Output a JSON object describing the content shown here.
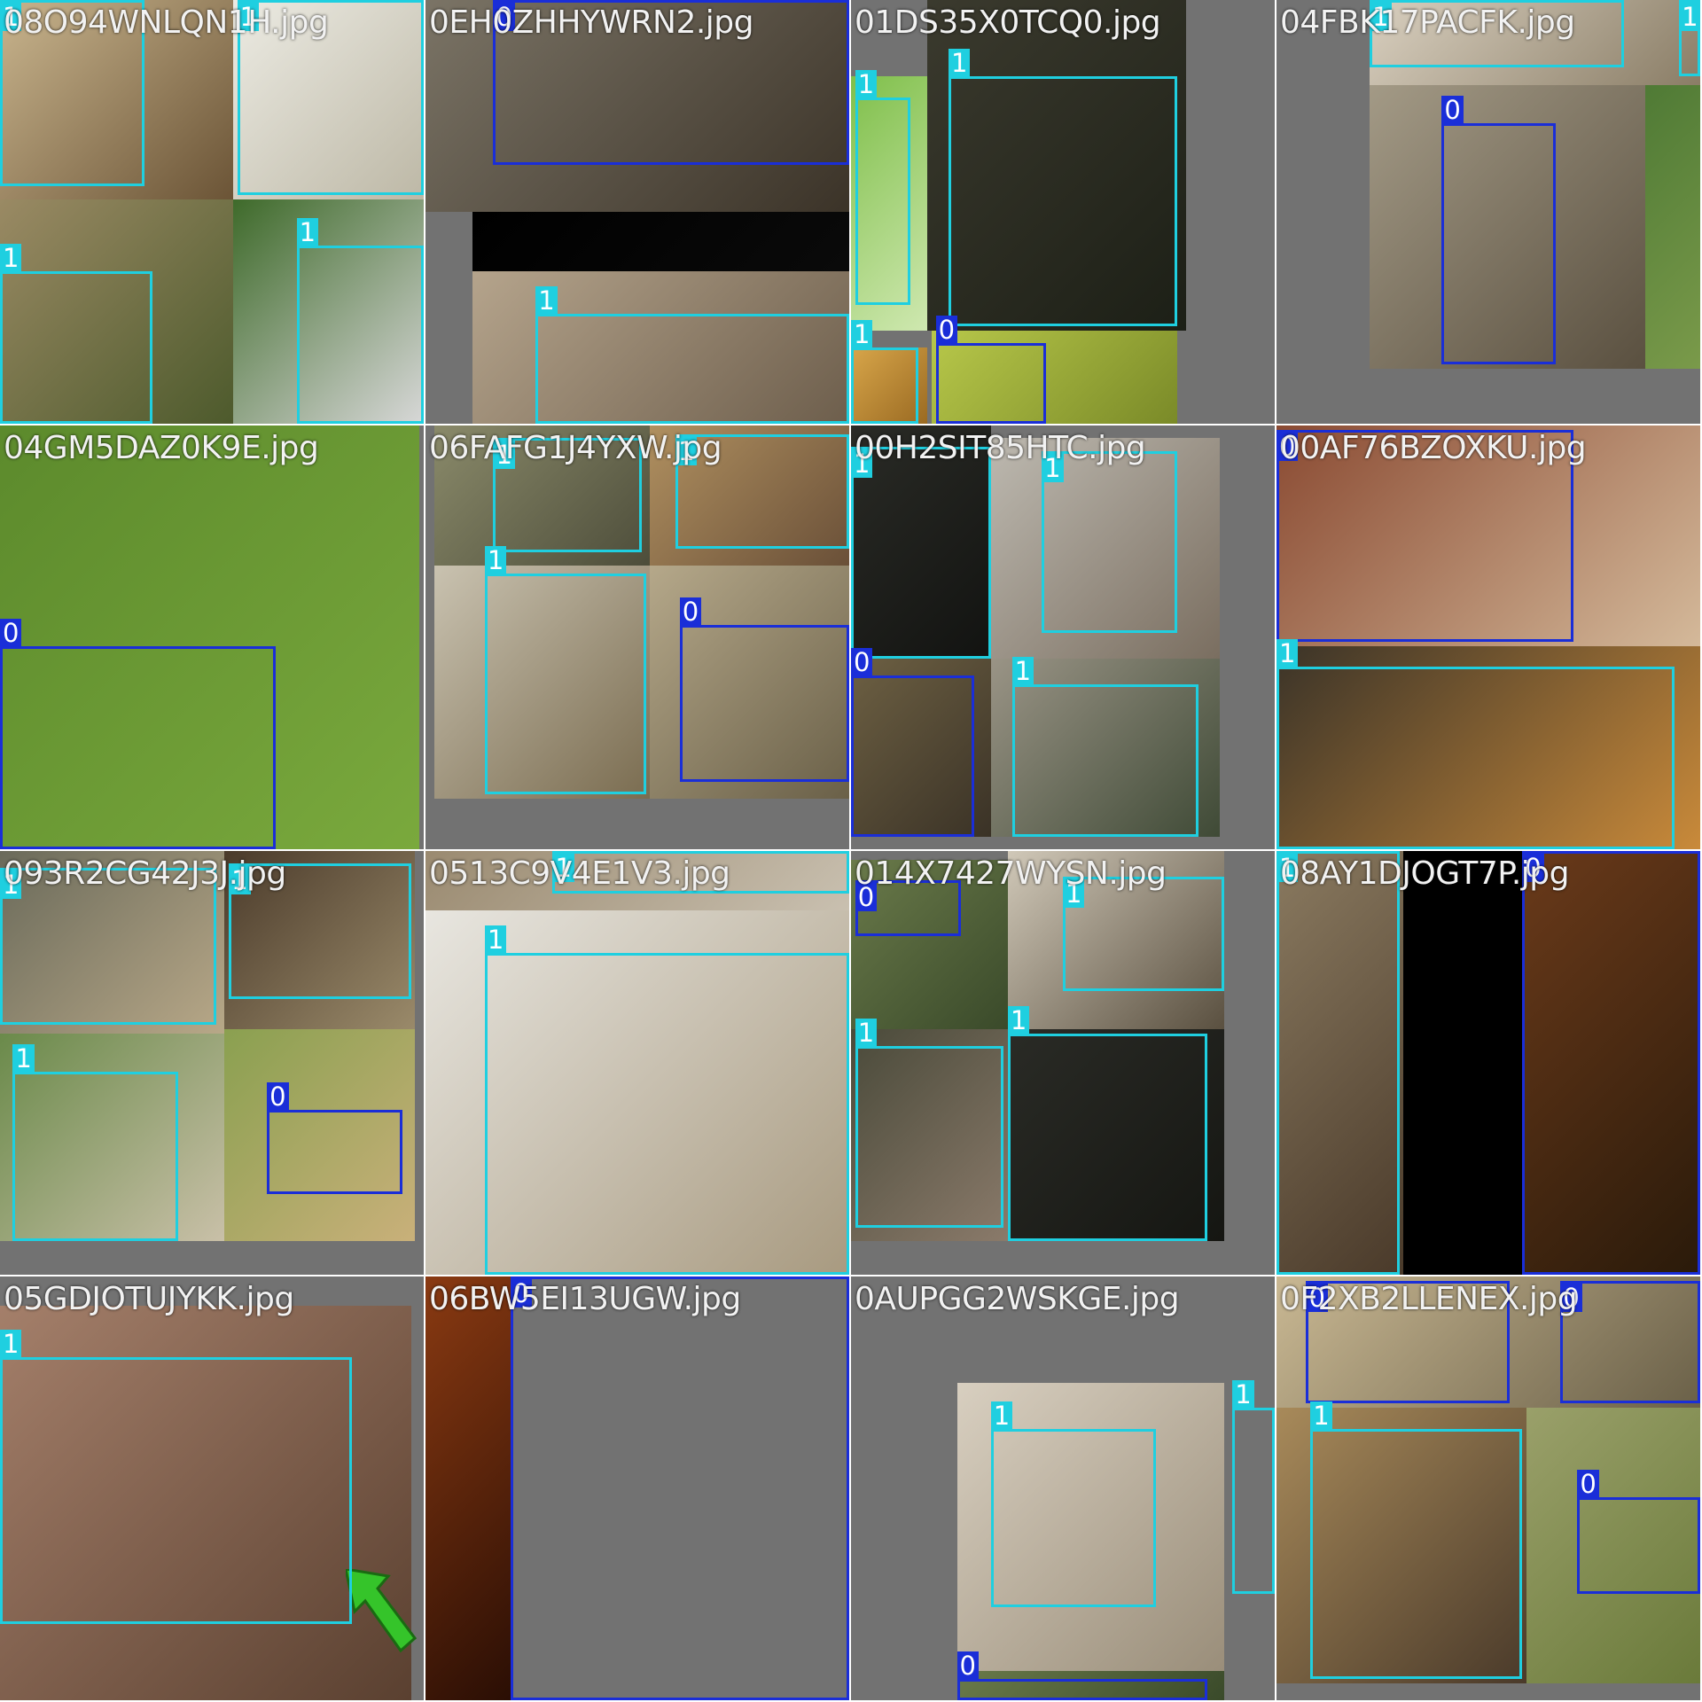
{
  "classes": {
    "0": {
      "color": "#1a2ed8"
    },
    "1": {
      "color": "#1fcfe0"
    }
  },
  "tiles": [
    {
      "filename": "08O94WNLQN1H.jpg",
      "photos": [
        [
          "#c9b58e",
          "#6b5436"
        ],
        [
          "#ecebe3",
          "#bdb8a6"
        ],
        [
          "#9a8a64",
          "#4d5a2c"
        ],
        [
          "#3e6a2a",
          "#d8d8d8"
        ]
      ],
      "boxes": [
        [
          "1",
          0,
          0,
          0.34,
          0.44
        ],
        [
          "1",
          0.56,
          0,
          1,
          0.46
        ],
        [
          "1",
          0,
          0.64,
          0.36,
          1
        ],
        [
          "1",
          0.7,
          0.58,
          1,
          1
        ]
      ]
    },
    {
      "filename": "0EH0ZHHYWRN2.jpg",
      "photos": [
        [
          "#7b7466",
          "#3b3328"
        ],
        [
          "#000000",
          "#0a0a0a"
        ],
        [
          "#b5a48c",
          "#6d5e4c"
        ]
      ],
      "boxes": [
        [
          "0",
          0.16,
          0,
          1,
          0.39
        ],
        [
          "1",
          0.26,
          0.74,
          1,
          1
        ]
      ]
    },
    {
      "filename": "01DS35X0TCQ0.jpg",
      "photos": [
        [
          "#3b3a2e",
          "#1c1f16"
        ],
        [
          "#7fbf4a",
          "#cfe8b0"
        ],
        [
          "#d8a64a",
          "#9a6a22"
        ],
        [
          "#b8c84a",
          "#7a8a28"
        ]
      ],
      "boxes": [
        [
          "1",
          0.23,
          0.18,
          0.77,
          0.77
        ],
        [
          "1",
          0.01,
          0.23,
          0.14,
          0.72
        ],
        [
          "1",
          0,
          0.82,
          0.16,
          1
        ],
        [
          "0",
          0.2,
          0.81,
          0.46,
          1
        ]
      ]
    },
    {
      "filename": "04FBK17PACFK.jpg",
      "photos": [
        [
          "#d9d0c0",
          "#8a7d66"
        ],
        [
          "#a39a86",
          "#5a5040"
        ],
        [
          "#4f7a35",
          "#7a9a4a"
        ]
      ],
      "boxes": [
        [
          "1",
          0.22,
          0,
          0.82,
          0.16
        ],
        [
          "0",
          0.39,
          0.29,
          0.66,
          0.86
        ],
        [
          "1",
          0.95,
          0,
          1,
          0.18
        ]
      ]
    },
    {
      "filename": "04GM5DAZ0K9E.jpg",
      "photos": [
        [
          "#5c8a2c",
          "#7aa93d"
        ]
      ],
      "boxes": [
        [
          "0",
          0,
          0.52,
          0.65,
          1
        ]
      ]
    },
    {
      "filename": "06FAFG1J4YXW.jpg",
      "photos": [
        [
          "#8a8a6a",
          "#4d4d3a"
        ],
        [
          "#b09060",
          "#6a5038"
        ],
        [
          "#c9c2b0",
          "#7a6c50"
        ],
        [
          "#b5a88a",
          "#6a6048"
        ]
      ],
      "boxes": [
        [
          "1",
          0.16,
          0.03,
          0.51,
          0.3
        ],
        [
          "1",
          0.59,
          0.02,
          1,
          0.29
        ],
        [
          "1",
          0.14,
          0.35,
          0.52,
          0.87
        ],
        [
          "0",
          0.6,
          0.47,
          1,
          0.84
        ]
      ]
    },
    {
      "filename": "00H2SIT85HTC.jpg",
      "photos": [
        [
          "#2a2b26",
          "#121311"
        ],
        [
          "#bdb9b0",
          "#7a6e60"
        ],
        [
          "#6d6043",
          "#3a3226"
        ],
        [
          "#9a9486",
          "#3f4a36"
        ]
      ],
      "boxes": [
        [
          "1",
          0,
          0.05,
          0.33,
          0.55
        ],
        [
          "1",
          0.45,
          0.06,
          0.77,
          0.49
        ],
        [
          "0",
          0,
          0.59,
          0.29,
          0.97
        ],
        [
          "1",
          0.38,
          0.61,
          0.82,
          0.97
        ]
      ]
    },
    {
      "filename": "00AF76BZOXKU.jpg",
      "photos": [
        [
          "#8a4a32",
          "#d4b99a"
        ],
        [
          "#3a3328",
          "#c98a3a"
        ]
      ],
      "boxes": [
        [
          "0",
          0,
          0.01,
          0.7,
          0.51
        ],
        [
          "1",
          0,
          0.57,
          0.94,
          1
        ]
      ]
    },
    {
      "filename": "093R2CG42J3J.jpg",
      "photos": [
        [
          "#6a6a5a",
          "#b8a888"
        ],
        [
          "#4a3a2a",
          "#9a8a6a"
        ],
        [
          "#6a8a4a",
          "#c9c0a8"
        ],
        [
          "#8aa050",
          "#c9b07a"
        ]
      ],
      "boxes": [
        [
          "1",
          0,
          0.04,
          0.51,
          0.41
        ],
        [
          "1",
          0.54,
          0.03,
          0.97,
          0.35
        ],
        [
          "1",
          0.03,
          0.52,
          0.42,
          0.92
        ],
        [
          "0",
          0.63,
          0.61,
          0.95,
          0.81
        ]
      ]
    },
    {
      "filename": "0513C9V4E1V3.jpg",
      "photos": [
        [
          "#9a8a70",
          "#c9c0b0"
        ],
        [
          "#e8e6e0",
          "#a89a80"
        ]
      ],
      "boxes": [
        [
          "1",
          0.3,
          0,
          1,
          0.1
        ],
        [
          "1",
          0.14,
          0.24,
          1,
          1
        ]
      ]
    },
    {
      "filename": "014X7427WYSN.jpg",
      "photos": [
        [
          "#6a7a4a",
          "#3a4a2a"
        ],
        [
          "#d0c8b8",
          "#5a5040"
        ],
        [
          "#4a4a3a",
          "#8a7a6a"
        ],
        [
          "#2a2b26",
          "#151612"
        ]
      ],
      "boxes": [
        [
          "0",
          0.01,
          0.07,
          0.26,
          0.2
        ],
        [
          "1",
          0.5,
          0.06,
          0.88,
          0.33
        ],
        [
          "1",
          0.01,
          0.46,
          0.36,
          0.89
        ],
        [
          "1",
          0.37,
          0.43,
          0.84,
          0.92
        ]
      ]
    },
    {
      "filename": "08AY1DJOGT7P.jpg",
      "photos": [
        [
          "#8a7a60",
          "#4a3a2a"
        ],
        [
          "#000000",
          "#000000"
        ],
        [
          "#6a3a1a",
          "#2a1a0a"
        ]
      ],
      "boxes": [
        [
          "1",
          0,
          0,
          0.29,
          1
        ],
        [
          "0",
          0.58,
          0,
          1,
          1
        ]
      ]
    },
    {
      "filename": "05GDJOTUJYKK.jpg",
      "photos": [
        [
          "#a47f6a",
          "#5a4030"
        ]
      ],
      "boxes": [
        [
          "1",
          0,
          0.19,
          0.83,
          0.82
        ]
      ]
    },
    {
      "filename": "06BW5EI13UGW.jpg",
      "photos": [
        [
          "#8a3a12",
          "#2a0e04"
        ]
      ],
      "boxes": [
        [
          "0",
          0.2,
          0,
          1,
          1
        ]
      ]
    },
    {
      "filename": "0AUPGG2WSKGE.jpg",
      "photos": [
        [
          "#d8cfc0",
          "#9a8e7a"
        ],
        [
          "#6a7a4a",
          "#3a4a2a"
        ]
      ],
      "boxes": [
        [
          "1",
          0.33,
          0.36,
          0.72,
          0.78
        ],
        [
          "1",
          0.9,
          0.31,
          1,
          0.75
        ],
        [
          "0",
          0.25,
          0.95,
          0.84,
          1
        ]
      ]
    },
    {
      "filename": "0F2XB2LLENEX.jpg",
      "photos": [
        [
          "#c9b893",
          "#6a6048"
        ],
        [
          "#a88a5a",
          "#4a3a2a"
        ],
        [
          "#9aa06a",
          "#6a7a3a"
        ]
      ],
      "boxes": [
        [
          "0",
          0.07,
          0.01,
          0.55,
          0.3
        ],
        [
          "0",
          0.67,
          0.01,
          1,
          0.3
        ],
        [
          "1",
          0.08,
          0.36,
          0.58,
          0.95
        ],
        [
          "0",
          0.71,
          0.52,
          1,
          0.75
        ]
      ]
    }
  ]
}
